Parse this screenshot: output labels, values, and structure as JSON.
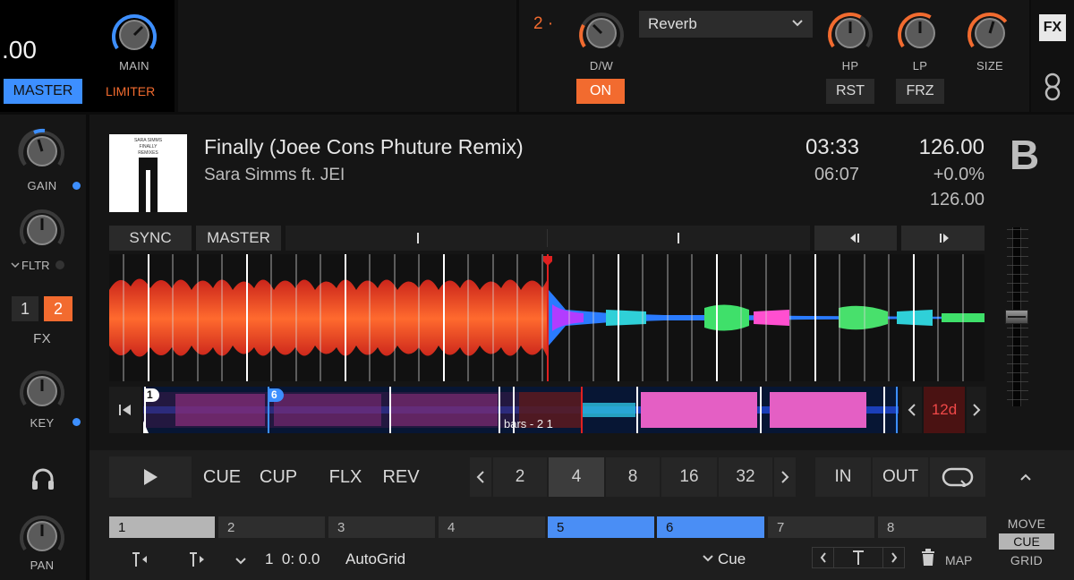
{
  "master_panel": {
    "tempo_fragment": ".00",
    "master_label": "MASTER",
    "main_label": "MAIN",
    "limiter_label": "LIMITER"
  },
  "fx_unit": {
    "unit_number": "2 ·",
    "effect_name": "Reverb",
    "dw_label": "D/W",
    "on_label": "ON",
    "hp_label": "HP",
    "lp_label": "LP",
    "size_label": "SIZE",
    "rst_label": "RST",
    "frz_label": "FRZ",
    "fx_button": "FX"
  },
  "left_strip": {
    "gain_label": "GAIN",
    "filter_label": "FLTR",
    "fx_assign": [
      "1",
      "2"
    ],
    "fx_label": "FX",
    "key_label": "KEY",
    "pan_label": "PAN"
  },
  "track": {
    "title": "Finally (Joee Cons Phuture Remix)",
    "artist": "Sara Simms ft. JEI",
    "elapsed": "03:33",
    "remaining": "06:07",
    "bpm": "126.00",
    "pitch": "+0.0%",
    "original_bpm": "126.00",
    "deck_letter": "B",
    "sync_label": "SYNC",
    "master_label": "MASTER",
    "art_text": [
      "SARA SIMMS",
      "FINALLY",
      "REMIXES"
    ]
  },
  "overview": {
    "cue_badges": [
      "1",
      "6"
    ],
    "bars_label": "bars - 2 1",
    "loop_badge": "12d"
  },
  "transport": {
    "cue": "CUE",
    "cup": "CUP",
    "flx": "FLX",
    "rev": "REV",
    "loop_sizes": [
      "2",
      "4",
      "8",
      "16",
      "32"
    ],
    "active_loop_size": "4",
    "in": "IN",
    "out": "OUT"
  },
  "hotcues": [
    {
      "num": "1",
      "state": "set-grey"
    },
    {
      "num": "2",
      "state": "empty"
    },
    {
      "num": "3",
      "state": "empty"
    },
    {
      "num": "4",
      "state": "empty"
    },
    {
      "num": "5",
      "state": "set-blue"
    },
    {
      "num": "6",
      "state": "set-blue"
    },
    {
      "num": "7",
      "state": "empty"
    },
    {
      "num": "8",
      "state": "empty"
    }
  ],
  "bottom_bar": {
    "cue_position": "1  0: 0.0",
    "autogrid": "AutoGrid",
    "cue_type": "Cue",
    "map": "MAP",
    "move": "MOVE",
    "cue_mode": "CUE",
    "grid": "GRID"
  },
  "colors": {
    "accent_orange": "#f26b2f",
    "accent_blue": "#3d8fff",
    "waveform_red": "#e33a1c",
    "hotcue_blue": "#4a8ef5"
  }
}
